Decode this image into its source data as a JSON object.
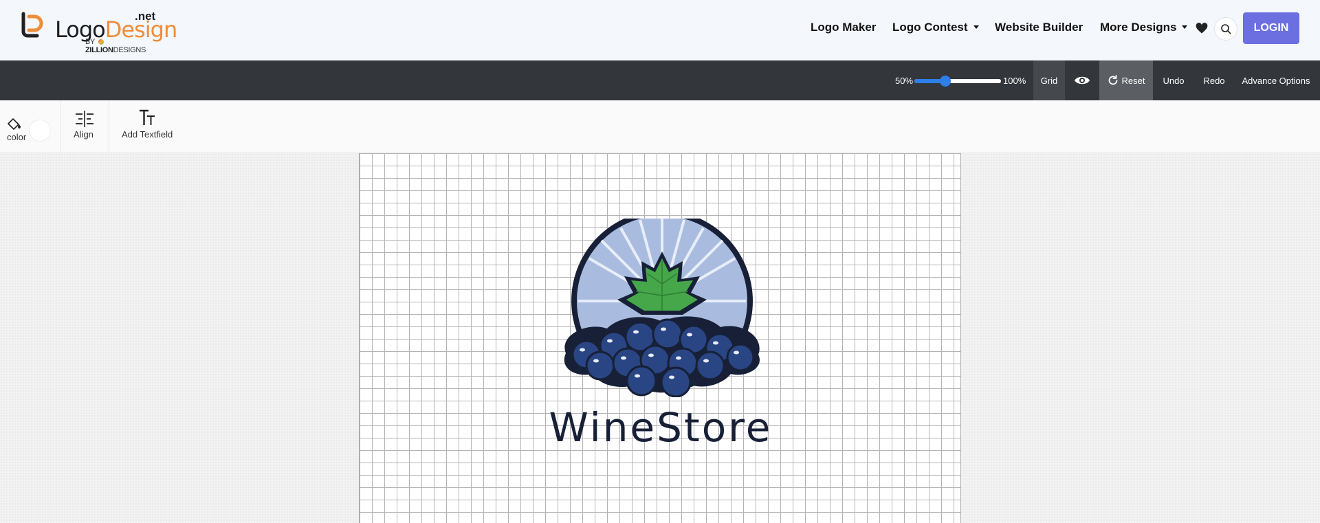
{
  "header": {
    "brand": {
      "logo": "Logo",
      "design": "Design",
      "net": ".net",
      "by": "BY",
      "company": "ZILLION",
      "company_suffix": "DESIGNS"
    },
    "nav": [
      {
        "label": "Logo Maker"
      },
      {
        "label": "Logo Contest"
      },
      {
        "label": "Website Builder"
      },
      {
        "label": "More Designs"
      }
    ],
    "login_label": "LOGIN"
  },
  "toolbar": {
    "zoom_min": "50%",
    "zoom_max": "100%",
    "zoom_fraction": 0.36,
    "grid_label": "Grid",
    "reset_label": "Reset",
    "undo_label": "Undo",
    "redo_label": "Redo",
    "advance_label": "Advance Options"
  },
  "tools": {
    "color_label": "color",
    "align_label": "Align",
    "text_label": "Add Textfield"
  },
  "canvas": {
    "logo_text": "WineStore",
    "colors": {
      "navy": "#172036",
      "sky": "#a9bce0",
      "leaf": "#46a74a",
      "grape": "#2a4584"
    }
  },
  "colors": {
    "accent_orange": "#ee8d3a",
    "login_bg": "#6b6fe0",
    "slider": "#2f7fe8",
    "toolbar_bg": "#33363b"
  }
}
